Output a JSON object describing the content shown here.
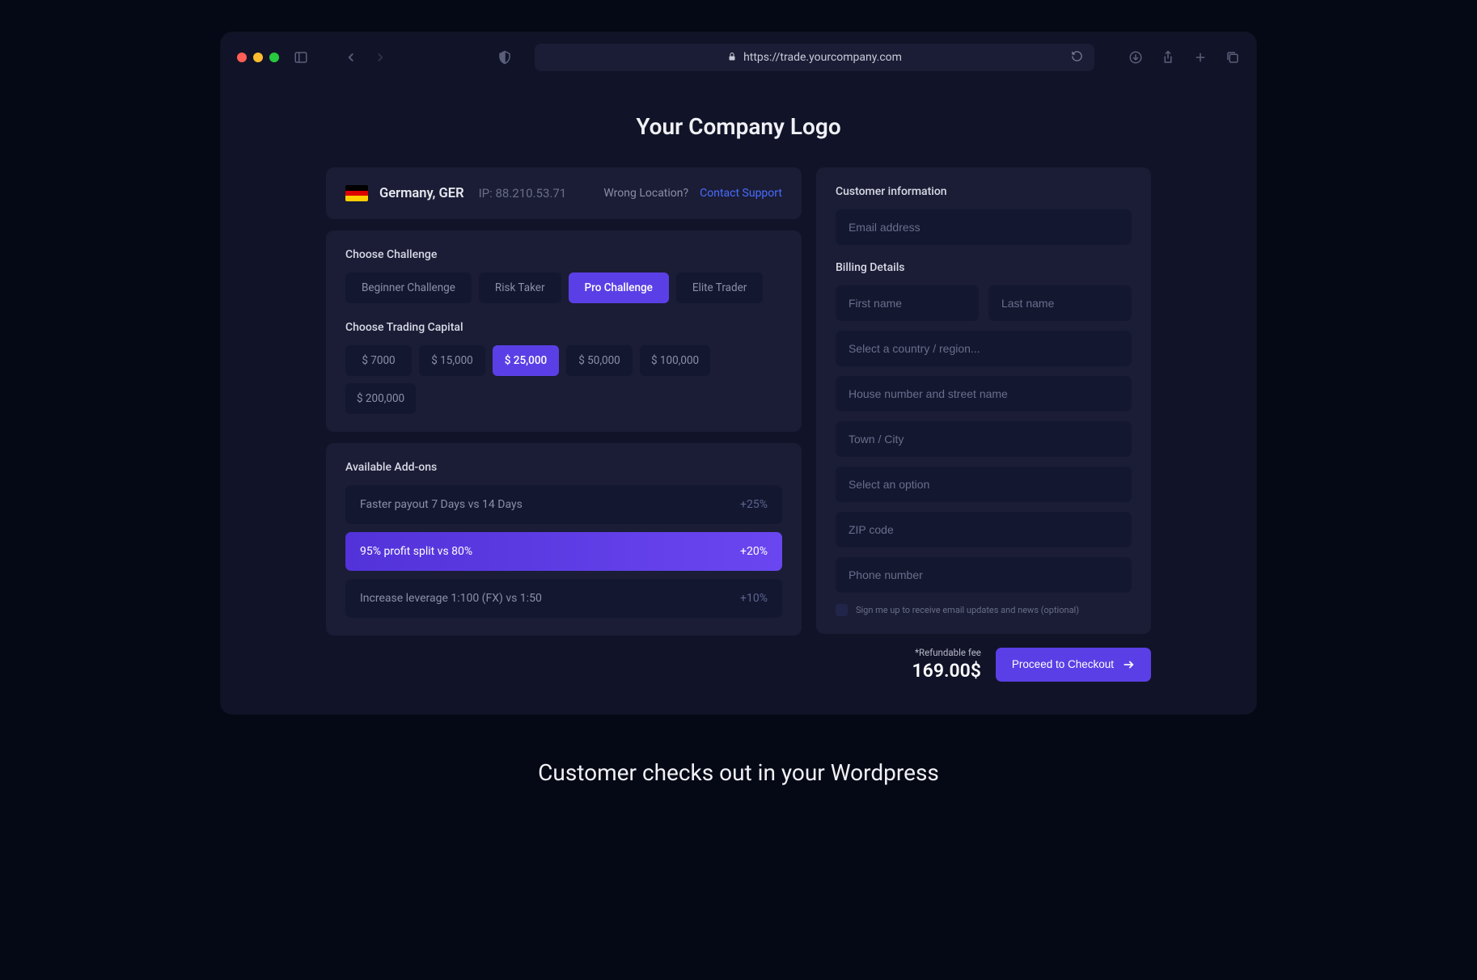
{
  "browser": {
    "url": "https://trade.yourcompany.com"
  },
  "header": {
    "logo_text": "Your Company Logo"
  },
  "location": {
    "country": "Germany, GER",
    "ip_label": "IP: 88.210.53.71",
    "wrong_location": "Wrong Location?",
    "contact_support": "Contact Support"
  },
  "challenge": {
    "title": "Choose Challenge",
    "options": [
      "Beginner Challenge",
      "Risk Taker",
      "Pro Challenge",
      "Elite Trader"
    ],
    "selected_index": 2
  },
  "capital": {
    "title": "Choose Trading Capital",
    "options": [
      "$ 7000",
      "$ 15,000",
      "$ 25,000",
      "$ 50,000",
      "$ 100,000",
      "$ 200,000"
    ],
    "selected_index": 2
  },
  "addons": {
    "title": "Available Add-ons",
    "items": [
      {
        "label": "Faster payout 7 Days vs 14 Days",
        "pct": "+25%",
        "selected": false
      },
      {
        "label": "95% profit split vs 80%",
        "pct": "+20%",
        "selected": true
      },
      {
        "label": "Increase leverage 1:100 (FX) vs 1:50",
        "pct": "+10%",
        "selected": false
      }
    ]
  },
  "form": {
    "customer_info_title": "Customer information",
    "email_placeholder": "Email address",
    "billing_title": "Billing Details",
    "first_name_placeholder": "First name",
    "last_name_placeholder": "Last name",
    "country_placeholder": "Select a country / region...",
    "address_placeholder": "House number and street name",
    "city_placeholder": "Town / City",
    "option_placeholder": "Select an option",
    "zip_placeholder": "ZIP code",
    "phone_placeholder": "Phone number",
    "optin_label": "Sign me up to receive email updates and news (optional)"
  },
  "checkout": {
    "fee_note": "*Refundable fee",
    "fee_amount": "169.00$",
    "button_label": "Proceed to Checkout"
  },
  "caption": "Customer checks out in your Wordpress"
}
